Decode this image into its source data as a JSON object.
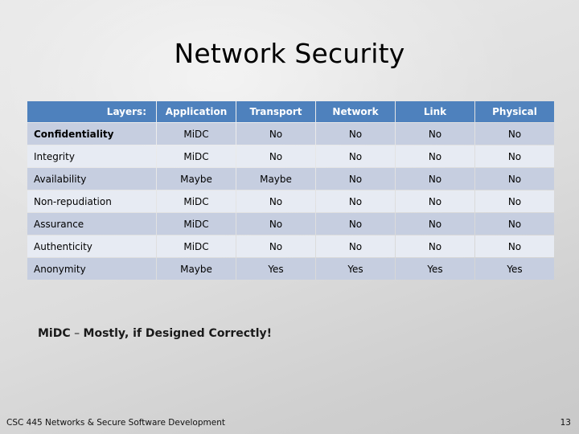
{
  "slide": {
    "title": "Network Security",
    "page_number": "13",
    "footer": "CSC 445 Networks & Secure Software Development",
    "footnote": {
      "abbrev": "MiDC",
      "separator": " – ",
      "expansion": "Mostly, if Designed Correctly!",
      "full": "MiDC – Mostly, if Designed Correctly!"
    }
  },
  "colors": {
    "header_blue": "#4E81BD",
    "row_dark": "#C6CEE0",
    "row_light": "#E7EBF3",
    "header_text": "#FFFFFF",
    "body_text": "#000000",
    "background_light": "#E8E8E8",
    "background_dark": "#C9C9C9"
  },
  "table": {
    "headers": [
      "Layers:",
      "Application",
      "Transport",
      "Network",
      "Link",
      "Physical"
    ],
    "rows": [
      {
        "label": "Confidentiality",
        "bold": true,
        "shade": "dark",
        "values": [
          "MiDC",
          "No",
          "No",
          "No",
          "No"
        ]
      },
      {
        "label": "Integrity",
        "bold": false,
        "shade": "light",
        "values": [
          "MiDC",
          "No",
          "No",
          "No",
          "No"
        ]
      },
      {
        "label": "Availability",
        "bold": false,
        "shade": "dark",
        "values": [
          "Maybe",
          "Maybe",
          "No",
          "No",
          "No"
        ]
      },
      {
        "label": "Non-repudiation",
        "bold": false,
        "shade": "light",
        "values": [
          "MiDC",
          "No",
          "No",
          "No",
          "No"
        ]
      },
      {
        "label": "Assurance",
        "bold": false,
        "shade": "dark",
        "values": [
          "MiDC",
          "No",
          "No",
          "No",
          "No"
        ]
      },
      {
        "label": "Authenticity",
        "bold": false,
        "shade": "light",
        "values": [
          "MiDC",
          "No",
          "No",
          "No",
          "No"
        ]
      },
      {
        "label": "Anonymity",
        "bold": false,
        "shade": "dark",
        "values": [
          "Maybe",
          "Yes",
          "Yes",
          "Yes",
          "Yes"
        ]
      }
    ]
  }
}
